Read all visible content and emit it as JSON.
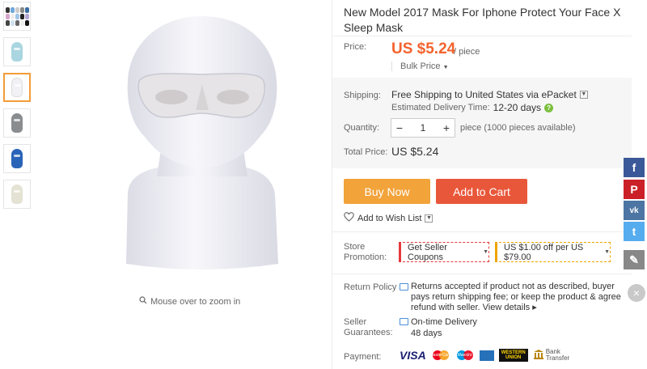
{
  "product": {
    "title": "New Model 2017 Mask For Iphone Protect Your Face X Sleep Mask",
    "zoom_hint": "Mouse over to zoom in"
  },
  "price": {
    "label": "Price:",
    "value": "US $5.24",
    "unit": "/ piece",
    "bulk_label": "Bulk Price"
  },
  "shipping": {
    "label": "Shipping:",
    "text": "Free Shipping to United States via ePacket",
    "delivery_label": "Estimated Delivery Time:",
    "delivery_value": "12-20 days"
  },
  "quantity": {
    "label": "Quantity:",
    "value": "1",
    "minus": "−",
    "plus": "+",
    "note": "piece (1000 pieces available)"
  },
  "total": {
    "label": "Total Price:",
    "value": "US $5.24"
  },
  "actions": {
    "buy_now": "Buy Now",
    "add_to_cart": "Add to Cart",
    "wishlist": "Add to Wish List"
  },
  "promotion": {
    "label_line1": "Store",
    "label_line2": "Promotion:",
    "coupon_button": "Get Seller Coupons",
    "discount": "US $1.00 off per US $79.00"
  },
  "return_policy": {
    "label": "Return Policy",
    "text": "Returns accepted if product not as described, buyer pays return shipping fee; or keep the product & agree refund with seller.",
    "link": "View details"
  },
  "guarantees": {
    "label_line1": "Seller",
    "label_line2": "Guarantees:",
    "line1": "On-time Delivery",
    "line2": "48 days"
  },
  "payment": {
    "label": "Payment:",
    "visa": "VISA",
    "mastercard": "MasterCard",
    "maestro": "Maestro",
    "western_union_1": "WESTERN",
    "western_union_2": "UNION",
    "bank_1": "Bank",
    "bank_2": "Transfer"
  },
  "social": {
    "facebook": "f",
    "pinterest": "P",
    "vk": "vk",
    "twitter": "t",
    "edit": "✎",
    "close": "×"
  },
  "colors": {
    "price": "#f4632d",
    "buy_now": "#f2a33a",
    "add_to_cart": "#e9573a",
    "thumb_active": "#f39c38"
  }
}
